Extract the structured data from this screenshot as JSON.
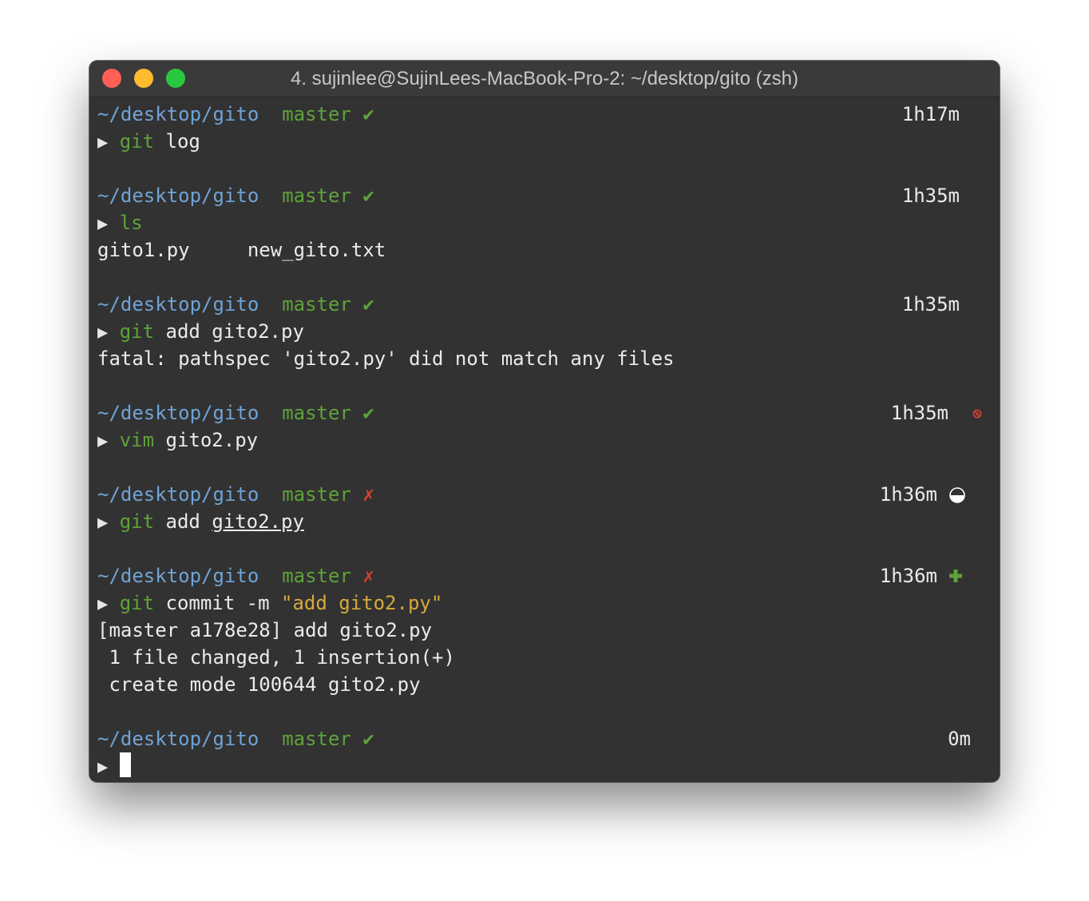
{
  "window": {
    "title": "4. sujinlee@SujinLees-MacBook-Pro-2: ~/desktop/gito (zsh)"
  },
  "colors": {
    "background": "#323232",
    "path": "#6fa3d7",
    "branch": "#5fa23a",
    "error": "#d1432f",
    "string": "#d8a93a"
  },
  "prompt": {
    "path": "~/desktop/gito",
    "branch": "master",
    "clean_mark": "✔",
    "dirty_mark": "✗",
    "arrow": "▶"
  },
  "blocks": [
    {
      "time": "1h17m",
      "cmd": "git",
      "args": " log"
    },
    {
      "time": "1h35m",
      "cmd": "ls",
      "output": [
        "gito1.py     new_gito.txt"
      ]
    },
    {
      "time": "1h35m",
      "cmd": "git",
      "args": " add gito2.py",
      "output": [
        "fatal: pathspec 'gito2.py' did not match any files"
      ]
    },
    {
      "time": "1h35m",
      "cmd": "vim",
      "args": " gito2.py",
      "status_icon": "no-pencil-icon"
    },
    {
      "time": "1h36m",
      "cmd": "git",
      "args_pre": " add ",
      "args_underlined": "gito2.py",
      "status_icon": "half-circle-icon"
    },
    {
      "time": "1h36m",
      "cmd": "git",
      "args": " commit -m ",
      "string_arg": "\"add gito2.py\"",
      "status_icon": "plus-icon",
      "output": [
        "[master a178e28] add gito2.py",
        " 1 file changed, 1 insertion(+)",
        " create mode 100644 gito2.py"
      ]
    },
    {
      "time": "0m"
    }
  ]
}
